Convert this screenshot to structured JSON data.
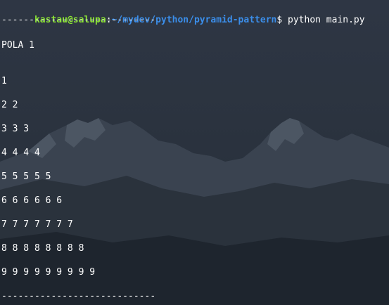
{
  "prompt": {
    "user_host": "kastau@salupa",
    "colon": ":",
    "path": "~/mydev/python/pyramid-pattern",
    "dollar": "$ ",
    "command": "python main.py"
  },
  "separator_top": "----------------------------",
  "title": "POLA 1",
  "rows": [
    "1",
    "2 2",
    "3 3 3",
    "4 4 4 4",
    "5 5 5 5 5",
    "6 6 6 6 6 6",
    "7 7 7 7 7 7 7",
    "8 8 8 8 8 8 8 8",
    "9 9 9 9 9 9 9 9 9"
  ],
  "separator_bottom": "----------------------------",
  "colors": {
    "user": "#8ae234",
    "path": "#3b8eea",
    "text": "#ffffff",
    "background": "#2c3440"
  }
}
